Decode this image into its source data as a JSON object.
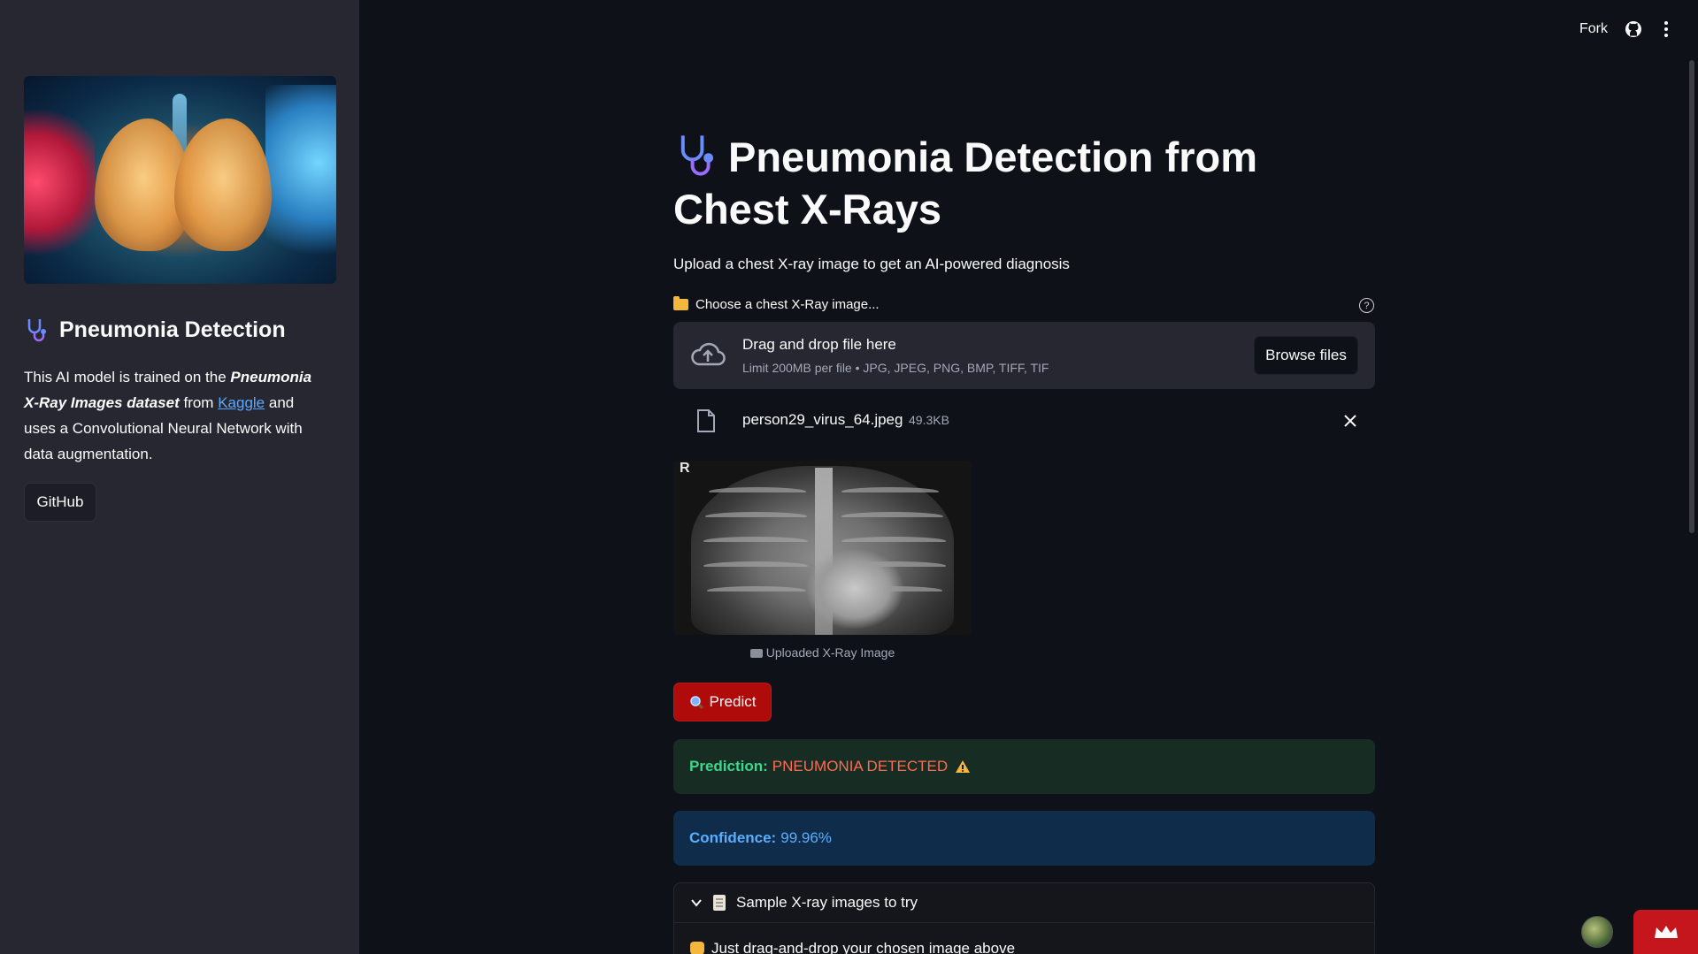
{
  "topbar": {
    "fork_label": "Fork",
    "github_icon": "github-icon",
    "more_icon": "kebab-menu-icon"
  },
  "sidebar": {
    "hero_image": "lungs-illustration",
    "title": "Pneumonia Detection",
    "desc": {
      "p1": "This AI model is trained on the ",
      "em": "Pneumonia X-Ray Images dataset",
      "p2": " from ",
      "link": "Kaggle",
      "p3": " and uses a Convolutional Neural Network with data augmentation."
    },
    "github_button": "GitHub"
  },
  "main": {
    "title": "Pneumonia Detection from Chest X-Rays",
    "subtitle": "Upload a chest X-ray image to get an AI-powered diagnosis",
    "uploader": {
      "label": "Choose a chest X-Ray image...",
      "drop_title": "Drag and drop file here",
      "drop_sub": "Limit 200MB per file • JPG, JPEG, PNG, BMP, TIFF, TIF",
      "browse_label": "Browse files"
    },
    "file": {
      "name": "person29_virus_64.jpeg",
      "size": "49.3KB"
    },
    "image": {
      "marker": "R",
      "caption": "Uploaded X-Ray Image"
    },
    "predict_label": "Predict",
    "prediction": {
      "label": "Prediction:",
      "value": "PNEUMONIA DETECTED"
    },
    "confidence": {
      "label": "Confidence:",
      "value": "99.96%"
    },
    "expander": {
      "title": "Sample X-ray images to try",
      "body": "Just drag-and-drop your chosen image above"
    }
  },
  "colors": {
    "background": "#0e1117",
    "sidebar": "#262730",
    "predict_button": "#b00b0b",
    "success_bg": "#172d23",
    "success_text": "#3dd68c",
    "danger_text": "#ff6b52",
    "info_bg": "#0f2c4a",
    "info_text": "#5aaeff",
    "link": "#5ba9ff"
  }
}
